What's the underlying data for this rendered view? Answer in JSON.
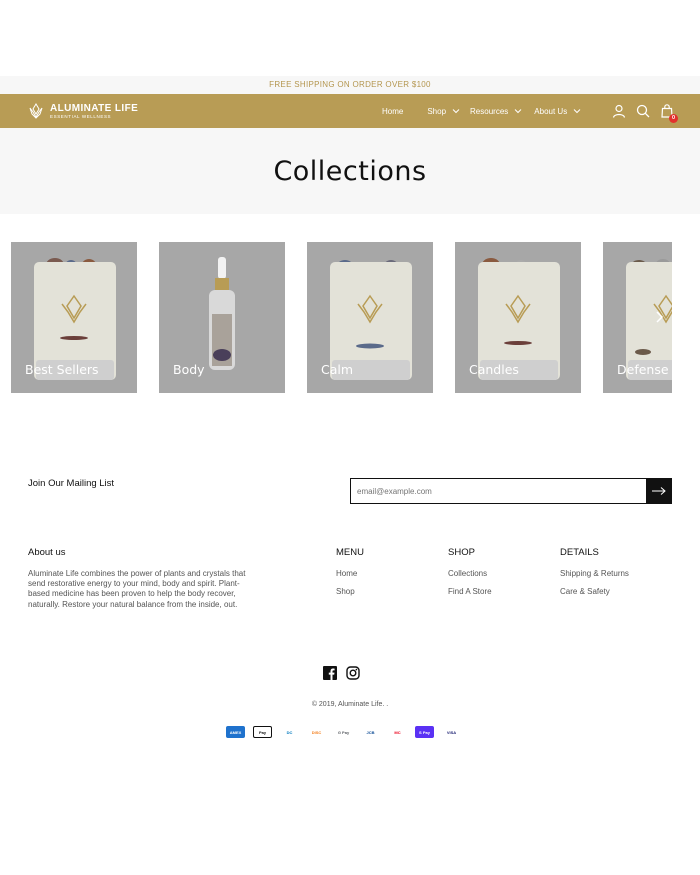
{
  "announcement": "FREE SHIPPING ON ORDER OVER $100",
  "brand": {
    "name": "ALUMINATE LIFE",
    "tagline": "ESSENTIAL WELLNESS"
  },
  "nav": {
    "home": "Home",
    "shop": "Shop",
    "resources": "Resources",
    "about": "About Us"
  },
  "cart": {
    "count": "0"
  },
  "colors": {
    "brand_gold": "#b89c55",
    "announcement_text": "#b4964f",
    "badge": "#e3312d"
  },
  "page_title": "Collections",
  "collections": [
    "Best Sellers",
    "Body",
    "Calm",
    "Candles",
    "Defense"
  ],
  "mailing": {
    "label": "Join Our Mailing List",
    "placeholder": "email@example.com"
  },
  "about": {
    "heading": "About us",
    "text": "Aluminate Life combines the power of plants and crystals that send restorative energy to your mind, body and spirit. Plant-based medicine has been proven to help the body recover, naturally. Restore your natural balance from the inside, out."
  },
  "footer_menu": {
    "heading": "MENU",
    "items": [
      "Home",
      "Shop"
    ]
  },
  "footer_shop": {
    "heading": "SHOP",
    "items": [
      "Collections",
      "Find A Store"
    ]
  },
  "footer_details": {
    "heading": "DETAILS",
    "items": [
      "Shipping & Returns",
      "Care & Safety"
    ]
  },
  "copyright": "© 2019, Aluminate Life. .",
  "payments": [
    {
      "label": "AMEX",
      "icon": "amex-icon"
    },
    {
      "label": "Pay",
      "icon": "apple-pay-icon"
    },
    {
      "label": "DC",
      "icon": "diners-club-icon"
    },
    {
      "label": "DISC",
      "icon": "discover-icon"
    },
    {
      "label": "G Pay",
      "icon": "google-pay-icon"
    },
    {
      "label": "JCB",
      "icon": "jcb-icon"
    },
    {
      "label": "MC",
      "icon": "mastercard-icon"
    },
    {
      "label": "S Pay",
      "icon": "shop-pay-icon"
    },
    {
      "label": "VISA",
      "icon": "visa-icon"
    }
  ]
}
